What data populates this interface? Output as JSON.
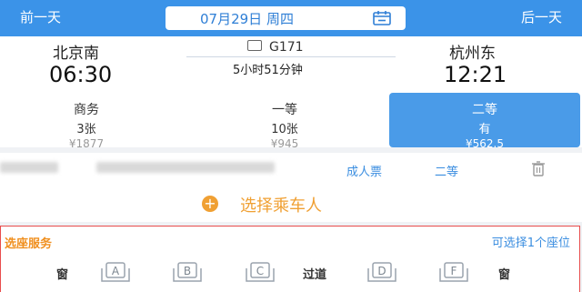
{
  "nav": {
    "prev_day": "前一天",
    "next_day": "后一天",
    "date": "07月29日 周四"
  },
  "train": {
    "from_station": "北京南",
    "depart_time": "06:30",
    "to_station": "杭州东",
    "arrive_time": "12:21",
    "number": "G171",
    "duration": "5小时51分钟"
  },
  "seat_classes": [
    {
      "name": "商务",
      "count": "3张",
      "price": "¥1877",
      "selected": false
    },
    {
      "name": "一等",
      "count": "10张",
      "price": "¥945",
      "selected": false
    },
    {
      "name": "二等",
      "count": "有",
      "price": "¥562.5",
      "selected": true
    }
  ],
  "passenger": {
    "ticket_type": "成人票",
    "seat_class": "二等"
  },
  "add_passenger": {
    "label": "选择乘车人",
    "icon": "plus-circle-icon"
  },
  "seat_service": {
    "title": "选座服务",
    "hint": "可选择1个座位",
    "window_left": "窗",
    "aisle": "过道",
    "window_right": "窗",
    "seats": [
      "A",
      "B",
      "C",
      "D",
      "F"
    ]
  },
  "colors": {
    "accent": "#3b93e8",
    "orange": "#f0a033",
    "border_red": "#e84c4c"
  }
}
